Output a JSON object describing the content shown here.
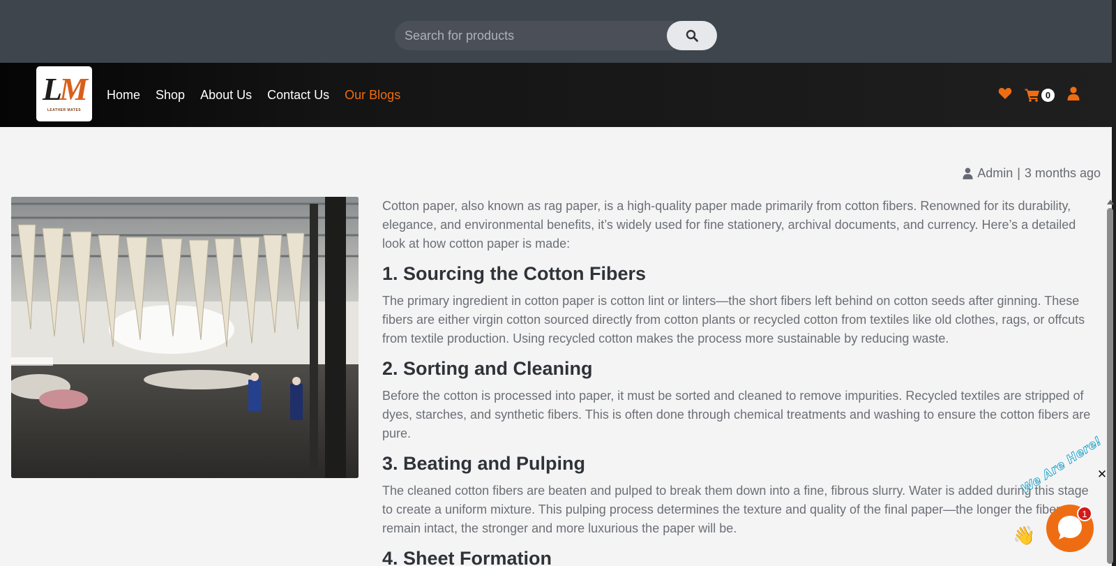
{
  "search": {
    "placeholder": "Search for products",
    "button_icon": "search-icon"
  },
  "logo": {
    "letter_l": "L",
    "letter_m": "M",
    "tagline": "LEATHER MATES"
  },
  "nav": {
    "items": [
      {
        "label": "Home",
        "active": false
      },
      {
        "label": "Shop",
        "active": false
      },
      {
        "label": "About Us",
        "active": false
      },
      {
        "label": "Contact Us",
        "active": false
      },
      {
        "label": "Our Blogs",
        "active": true
      }
    ],
    "icons": [
      "heart-icon",
      "cart-icon",
      "user-icon"
    ],
    "cart_count": "0"
  },
  "post": {
    "author": "Admin",
    "separator": "|",
    "time_ago": "3 months ago",
    "intro": "Cotton paper, also known as rag paper, is a high-quality paper made primarily from cotton fibers. Renowned for its durability, elegance, and environmental benefits, it’s widely used for fine stationery, archival documents, and currency. Here’s a detailed look at how cotton paper is made:",
    "sections": [
      {
        "heading": "1. Sourcing the Cotton Fibers",
        "body": "The primary ingredient in cotton paper is cotton lint or linters—the short fibers left behind on cotton seeds after ginning. These fibers are either virgin cotton sourced directly from cotton plants or recycled cotton from textiles like old clothes, rags, or offcuts from textile production. Using recycled cotton makes the process more sustainable by reducing waste."
      },
      {
        "heading": "2. Sorting and Cleaning",
        "body": "Before the cotton is processed into paper, it must be sorted and cleaned to remove impurities. Recycled textiles are stripped of dyes, starches, and synthetic fibers. This is often done through chemical treatments and washing to ensure the cotton fibers are pure."
      },
      {
        "heading": "3. Beating and Pulping",
        "body": "The cleaned cotton fibers are beaten and pulped to break them down into a fine, fibrous slurry. Water is added during this stage to create a uniform mixture. This pulping process determines the texture and quality of the final paper—the longer the fibers remain intact, the stronger and more luxurious the paper will be."
      },
      {
        "heading": "4. Sheet Formation",
        "body": ""
      }
    ]
  },
  "chat": {
    "caption": "We Are Here!",
    "unread": "1",
    "close_glyph": "✕"
  },
  "colors": {
    "accent": "#ef6d12",
    "topbar": "#3f454d",
    "navbar": "#1f1f1f",
    "page_bg": "#f4f4f4",
    "heading": "#2f3338",
    "body_text": "#6b6f75"
  }
}
